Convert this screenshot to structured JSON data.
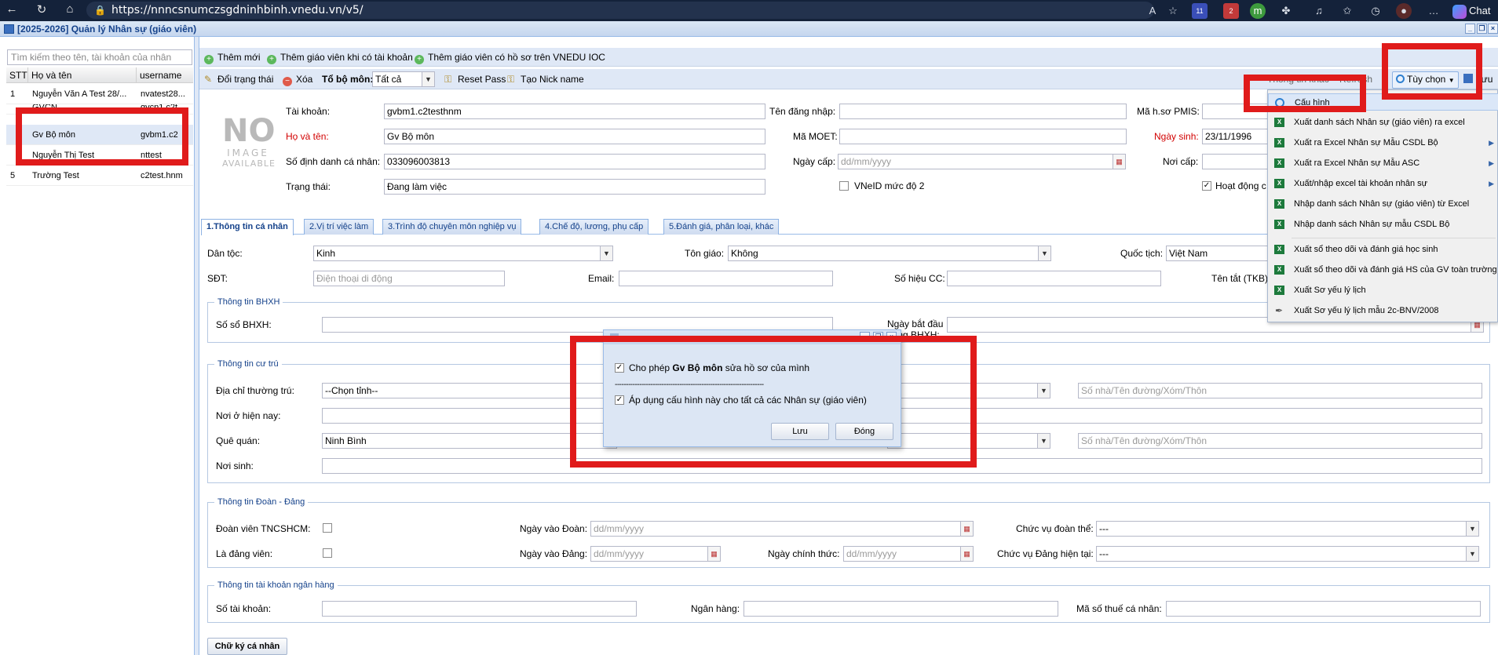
{
  "browser": {
    "url": "https://nnncsnumczsgdninhbinh.vnedu.vn/v5/",
    "chat_label": "Chat",
    "badge_1": "11",
    "badge_2": "2"
  },
  "window": {
    "title": "[2025-2026] Quản lý Nhân sự (giáo viên)"
  },
  "left": {
    "search_placeholder": "Tìm kiếm theo tên, tài khoản của nhân sự...",
    "columns": [
      "STT",
      "Họ và tên",
      "username"
    ],
    "rows": [
      {
        "stt": "1",
        "name": "Nguyễn Văn A Test 28/...",
        "username": "nvatest28..."
      },
      {
        "stt": "",
        "name": "GVCN",
        "username": "gvcn1.c2t"
      },
      {
        "stt": "",
        "name": "Gv Bộ môn",
        "username": "gvbm1.c2"
      },
      {
        "stt": "",
        "name": "Nguyễn Thị Test",
        "username": "nttest"
      },
      {
        "stt": "5",
        "name": "Trường Test",
        "username": "c2test.hnm"
      }
    ]
  },
  "toolbar1": {
    "add_new": "Thêm mới",
    "add_with_account": "Thêm giáo viên khi có tài khoản",
    "add_from_ioc": "Thêm giáo viên có hồ sơ trên VNEDU IOC"
  },
  "toolbar2": {
    "change_status": "Đổi trạng thái",
    "delete": "Xóa",
    "group_label": "Tổ bộ môn:",
    "group_value": "Tất cả",
    "reset_pass": "Reset Pass",
    "nickname": "Tạo Nick name",
    "hidden_item": "Thông tin khác",
    "refresh": "Refresh",
    "options": "Tùy chọn",
    "save": "Lưu"
  },
  "profile": {
    "no_image": [
      "NO",
      "IMAGE",
      "AVAILABLE"
    ],
    "account_label": "Tài khoản:",
    "account_value": "gvbm1.c2testhnm",
    "fullname_label": "Họ và tên:",
    "fullname_value": "Gv Bộ môn",
    "id_label": "Số định danh cá nhân:",
    "id_value": "033096003813",
    "status_label": "Trạng thái:",
    "status_value": "Đang làm việc",
    "login_label": "Tên đăng nhập:",
    "moet_label": "Mã MOET:",
    "issue_date_label": "Ngày cấp:",
    "date_placeholder": "dd/mm/yyyy",
    "vneid_label": "VNeID mức độ 2",
    "pmis_label": "Mã h.sơ PMIS:",
    "dob_label": "Ngày sinh:",
    "dob_value": "23/11/1996",
    "issue_place_label": "Nơi cấp:",
    "active_label": "Hoạt động c"
  },
  "tabs": [
    "1.Thông tin cá nhân",
    "2.Vị trí việc làm",
    "3.Trình độ chuyên môn nghiệp vụ",
    "4.Chế độ, lương, phụ cấp",
    "5.Đánh giá, phân loại, khác"
  ],
  "personal": {
    "ethnic_label": "Dân tộc:",
    "ethnic_value": "Kinh",
    "religion_label": "Tôn giáo:",
    "religion_value": "Không",
    "nationality_label": "Quốc tịch:",
    "nationality_value": "Việt Nam",
    "phone_label": "SĐT:",
    "phone_placeholder": "Điện thoại di động",
    "email_label": "Email:",
    "cc_label": "Số hiệu CC:",
    "short_name_label": "Tên tắt (TKB)"
  },
  "bhxh": {
    "legend": "Thông tin BHXH",
    "book_label": "Số sổ BHXH:",
    "start_label_1": "Ngày bắt đầu",
    "start_label_2": "đóng BHXH:"
  },
  "residence": {
    "legend": "Thông tin cư trú",
    "permanent_label": "Địa chỉ thường trú:",
    "province_placeholder": "--Chọn tỉnh--",
    "street_placeholder": "Số nhà/Tên đường/Xóm/Thôn",
    "current_label": "Nơi ở hiện nay:",
    "hometown_label": "Quê quán:",
    "hometown_value": "Ninh Bình",
    "birthplace_label": "Nơi sinh:"
  },
  "party": {
    "legend": "Thông tin Đoàn - Đảng",
    "youth_label": "Đoàn viên TNCSHCM:",
    "youth_date_label": "Ngày vào Đoàn:",
    "youth_role_label": "Chức vụ đoàn thể:",
    "party_label": "Là đảng viên:",
    "party_date_label": "Ngày vào Đảng:",
    "official_date_label": "Ngày chính thức:",
    "party_role_label": "Chức vụ Đảng hiện tại:",
    "dash": "---"
  },
  "bank": {
    "legend": "Thông tin tài khoản ngân hàng",
    "account_label": "Số tài khoản:",
    "bank_label": "Ngân hàng:",
    "tax_label": "Mã số thuế cá nhân:"
  },
  "signature_button": "Chữ ký cá nhân",
  "menu": [
    {
      "label": "Cấu hình",
      "icon": "gear-icon"
    },
    {
      "label": "Xuất danh sách Nhân sự (giáo viên) ra excel",
      "icon": "excel-icon"
    },
    {
      "label": "Xuất ra Excel Nhân sự Mẫu CSDL Bộ",
      "icon": "excel-icon",
      "sub": true
    },
    {
      "label": "Xuất ra Excel Nhân sự Mẫu ASC",
      "icon": "excel-icon",
      "sub": true
    },
    {
      "label": "Xuất/nhập excel tài khoản nhân sự",
      "icon": "excel-icon",
      "sub": true
    },
    {
      "label": "Nhập danh sách Nhân sự (giáo viên) từ Excel",
      "icon": "excel-icon"
    },
    {
      "label": "Nhập danh sách Nhân sự mẫu CSDL Bộ",
      "icon": "excel-icon"
    },
    {
      "label": "Xuất sổ theo dõi và đánh giá học sinh",
      "icon": "excel-icon"
    },
    {
      "label": "Xuất sổ theo dõi và đánh giá HS của GV toàn trường",
      "icon": "excel-icon"
    },
    {
      "label": "Xuất Sơ yếu lý lịch",
      "icon": "excel-icon"
    },
    {
      "label": "Xuất Sơ yếu lý lịch mẫu 2c-BNV/2008",
      "icon": "pen-icon"
    }
  ],
  "dialog": {
    "allow_prefix": "Cho phép ",
    "allow_name": "Gv Bộ môn",
    "allow_suffix": " sửa hồ sơ của mình",
    "separator": "-------------------------------------------------------------------",
    "apply_all": "Áp dụng cấu hình này cho tất cả các Nhân sự (giáo viên)",
    "save": "Lưu",
    "close": "Đóng"
  },
  "colors": {
    "highlight_red": "#e01b1b",
    "panel_blue": "#dfe8f6",
    "required_red": "#d20000"
  }
}
